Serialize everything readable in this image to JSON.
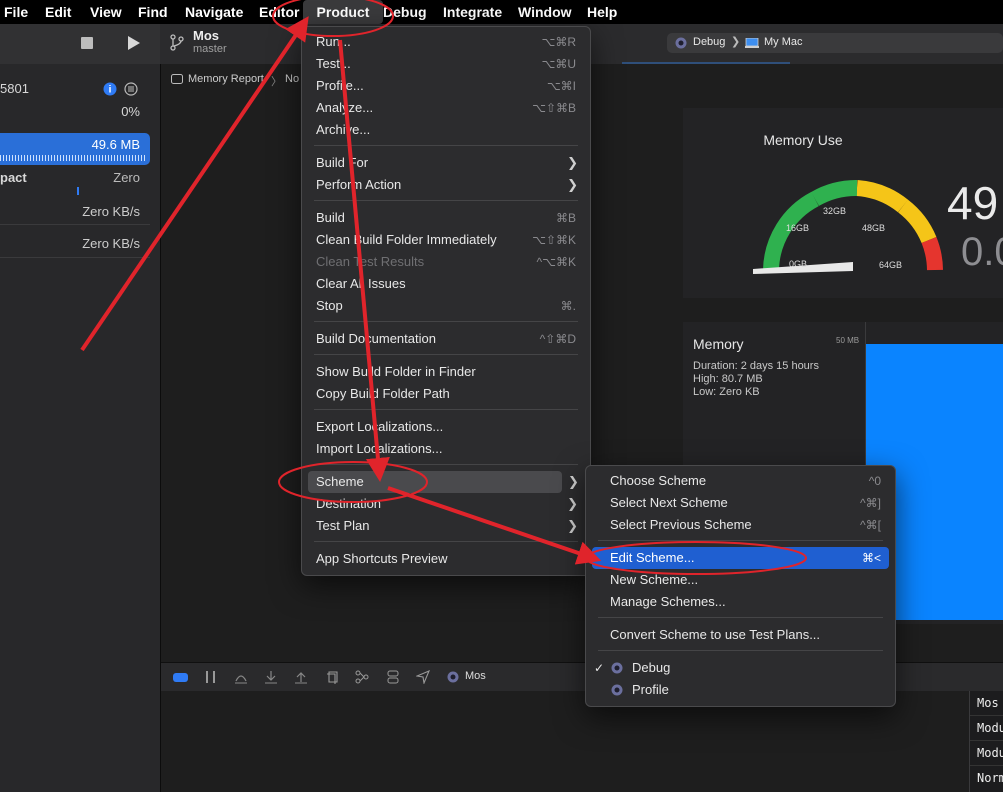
{
  "menubar": {
    "items": [
      "File",
      "Edit",
      "View",
      "Find",
      "Navigate",
      "Editor",
      "Product",
      "Debug",
      "Integrate",
      "Window",
      "Help"
    ]
  },
  "toolbar": {
    "project_name": "Mos",
    "branch": "master",
    "scheme_label": "Debug",
    "destination_label": "My Mac"
  },
  "sidebar": {
    "process_id": "5801",
    "cpu": "0%",
    "memory": "49.6 MB",
    "energy_label": "pact",
    "energy_value": "Zero",
    "disk_value": "Zero KB/s",
    "network_value": "Zero KB/s"
  },
  "jumpbar": {
    "report": "Memory Report",
    "sep": "〉",
    "trail": "No"
  },
  "memory_card": {
    "title": "Memory Use",
    "big_value": "49",
    "sub_value": "0.0",
    "gauge_labels": [
      "0GB",
      "16GB",
      "32GB",
      "48GB",
      "64GB"
    ]
  },
  "memory_graph": {
    "title": "Memory",
    "duration": "Duration: 2 days 15 hours",
    "high": "High: 80.7 MB",
    "low": "Low: Zero KB",
    "axis_top": "50 MB"
  },
  "debugbar": {
    "process": "Mos"
  },
  "console_lines": [
    "Mos",
    "Modu",
    "Modu",
    "Norm"
  ],
  "product_menu": {
    "items": [
      {
        "label": "Run...",
        "shortcut": "⌥⌘R"
      },
      {
        "label": "Test...",
        "shortcut": "⌥⌘U"
      },
      {
        "label": "Profile...",
        "shortcut": "⌥⌘I"
      },
      {
        "label": "Analyze...",
        "shortcut": "⌥⇧⌘B"
      },
      {
        "label": "Archive...",
        "shortcut": ""
      },
      {
        "label": "Build For",
        "shortcut": ""
      },
      {
        "label": "Perform Action",
        "shortcut": ""
      },
      {
        "label": "Build",
        "shortcut": "⌘B"
      },
      {
        "label": "Clean Build Folder Immediately",
        "shortcut": "⌥⇧⌘K"
      },
      {
        "label": "Clean Test Results",
        "shortcut": "^⌥⌘K"
      },
      {
        "label": "Clear All Issues",
        "shortcut": ""
      },
      {
        "label": "Stop",
        "shortcut": "⌘."
      },
      {
        "label": "Build Documentation",
        "shortcut": "^⇧⌘D"
      },
      {
        "label": "Show Build Folder in Finder",
        "shortcut": ""
      },
      {
        "label": "Copy Build Folder Path",
        "shortcut": ""
      },
      {
        "label": "Export Localizations...",
        "shortcut": ""
      },
      {
        "label": "Import Localizations...",
        "shortcut": ""
      },
      {
        "label": "Scheme",
        "shortcut": ""
      },
      {
        "label": "Destination",
        "shortcut": ""
      },
      {
        "label": "Test Plan",
        "shortcut": ""
      },
      {
        "label": "App Shortcuts Preview",
        "shortcut": ""
      }
    ]
  },
  "scheme_menu": {
    "items": [
      {
        "label": "Choose Scheme",
        "shortcut": "^0"
      },
      {
        "label": "Select Next Scheme",
        "shortcut": "^⌘]"
      },
      {
        "label": "Select Previous Scheme",
        "shortcut": "^⌘["
      },
      {
        "label": "Edit Scheme...",
        "shortcut": "⌘<"
      },
      {
        "label": "New Scheme...",
        "shortcut": ""
      },
      {
        "label": "Manage Schemes...",
        "shortcut": ""
      },
      {
        "label": "Convert Scheme to use Test Plans...",
        "shortcut": ""
      },
      {
        "label": "Debug",
        "shortcut": ""
      },
      {
        "label": "Profile",
        "shortcut": ""
      }
    ],
    "checkmark": "✓"
  },
  "colors": {
    "accent": "#1f5fd1",
    "annotation": "#e0242b",
    "graph_fill": "#0a84ff"
  }
}
